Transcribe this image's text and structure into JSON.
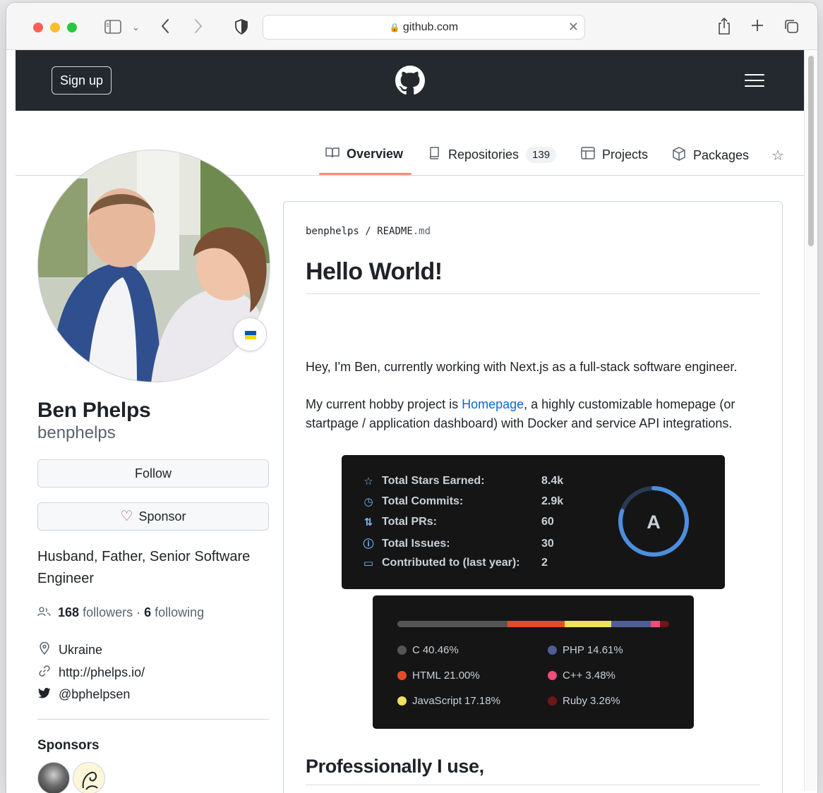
{
  "browser": {
    "url": "github.com",
    "traffic_lights": {
      "close": "#ff5f57",
      "minimize": "#febc2e",
      "maximize": "#28c840"
    }
  },
  "header": {
    "signup_label": "Sign up"
  },
  "tabs": [
    {
      "label": "Overview",
      "icon": "book-icon"
    },
    {
      "label": "Repositories",
      "count": "139",
      "icon": "repo-icon"
    },
    {
      "label": "Projects",
      "icon": "table-icon"
    },
    {
      "label": "Packages",
      "icon": "package-icon"
    },
    {
      "label": "",
      "icon": "star-icon"
    }
  ],
  "profile": {
    "name": "Ben Phelps",
    "login": "benphelps",
    "follow_label": "Follow",
    "sponsor_label": "Sponsor",
    "bio": "Husband, Father, Senior Software Engineer",
    "followers_count": "168",
    "followers_label": "followers",
    "following_count": "6",
    "following_label": "following",
    "location": "Ukraine",
    "website": "http://phelps.io/",
    "twitter": "@bphelpsen",
    "sponsors_heading": "Sponsors"
  },
  "readme": {
    "path_user": "benphelps",
    "path_sep": "/",
    "path_file": "README",
    "path_ext": ".md",
    "title": "Hello World!",
    "intro": "Hey, I'm Ben, currently working with Next.js as a full-stack software engineer.",
    "hobby_prefix": "My current hobby project is ",
    "hobby_link": "Homepage",
    "hobby_suffix": ", a highly customizable homepage (or startpage / application dashboard) with Docker and service API integrations.",
    "section_heading": "Professionally I use,"
  },
  "stats_card": {
    "rows": [
      {
        "label": "Total Stars Earned:",
        "value": "8.4k",
        "icon": "star-icon"
      },
      {
        "label": "Total Commits:",
        "value": "2.9k",
        "icon": "history-icon"
      },
      {
        "label": "Total PRs:",
        "value": "60",
        "icon": "pull-request-icon"
      },
      {
        "label": "Total Issues:",
        "value": "30",
        "icon": "issue-icon"
      },
      {
        "label": "Contributed to (last year):",
        "value": "2",
        "icon": "repo-icon"
      }
    ],
    "grade": "A",
    "ring_fraction": 0.8,
    "ring_color": "#4c8ee0"
  },
  "languages": [
    {
      "name": "C",
      "percent": "40.46%",
      "value": 40.46,
      "color": "#555555"
    },
    {
      "name": "HTML",
      "percent": "21.00%",
      "value": 21.0,
      "color": "#e34c26"
    },
    {
      "name": "JavaScript",
      "percent": "17.18%",
      "value": 17.18,
      "color": "#f1e05a"
    },
    {
      "name": "PHP",
      "percent": "14.61%",
      "value": 14.61,
      "color": "#4F5D95"
    },
    {
      "name": "C++",
      "percent": "3.48%",
      "value": 3.48,
      "color": "#f34b7d"
    },
    {
      "name": "Ruby",
      "percent": "3.26%",
      "value": 3.26,
      "color": "#701516"
    }
  ]
}
